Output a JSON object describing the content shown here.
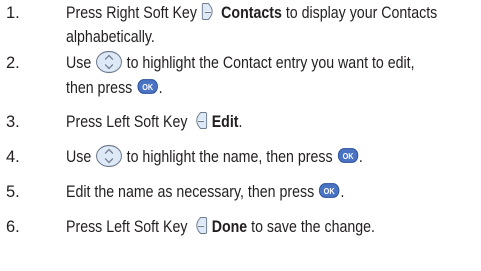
{
  "steps": [
    {
      "number": "1.",
      "lines": [
        [
          "Press Right Soft Key ",
          "",
          " ",
          "Contacts",
          " to display your Contacts"
        ],
        [
          "alphabetically."
        ]
      ]
    },
    {
      "number": "2.",
      "lines": [
        [
          "Use ",
          "",
          " to highlight the Contact entry you want to edit,"
        ],
        [
          "then press ",
          "",
          "."
        ]
      ]
    },
    {
      "number": "3.",
      "lines": [
        [
          "Press Left Soft Key ",
          "",
          " ",
          "Edit",
          "."
        ]
      ]
    },
    {
      "number": "4.",
      "lines": [
        [
          "Use ",
          "",
          " to highlight the name, then press ",
          "",
          "."
        ]
      ]
    },
    {
      "number": "5.",
      "lines": [
        [
          "Edit the name as necessary, then press ",
          "",
          "."
        ]
      ]
    },
    {
      "number": "6.",
      "lines": [
        [
          "Press Left Soft Key ",
          "",
          " ",
          "Done",
          " to save the change."
        ]
      ]
    }
  ],
  "icons": {
    "right_soft_key": "right-soft-key-icon",
    "left_soft_key": "left-soft-key-icon",
    "nav_key": "navigation-key-icon",
    "ok_key": "ok-key-icon",
    "ok_key_label": "OK"
  },
  "colors": {
    "text": "#231f20",
    "icon_fill": "#dde9f7",
    "icon_stroke": "#6d7b8d",
    "ok_fill": "#4a73c4"
  }
}
